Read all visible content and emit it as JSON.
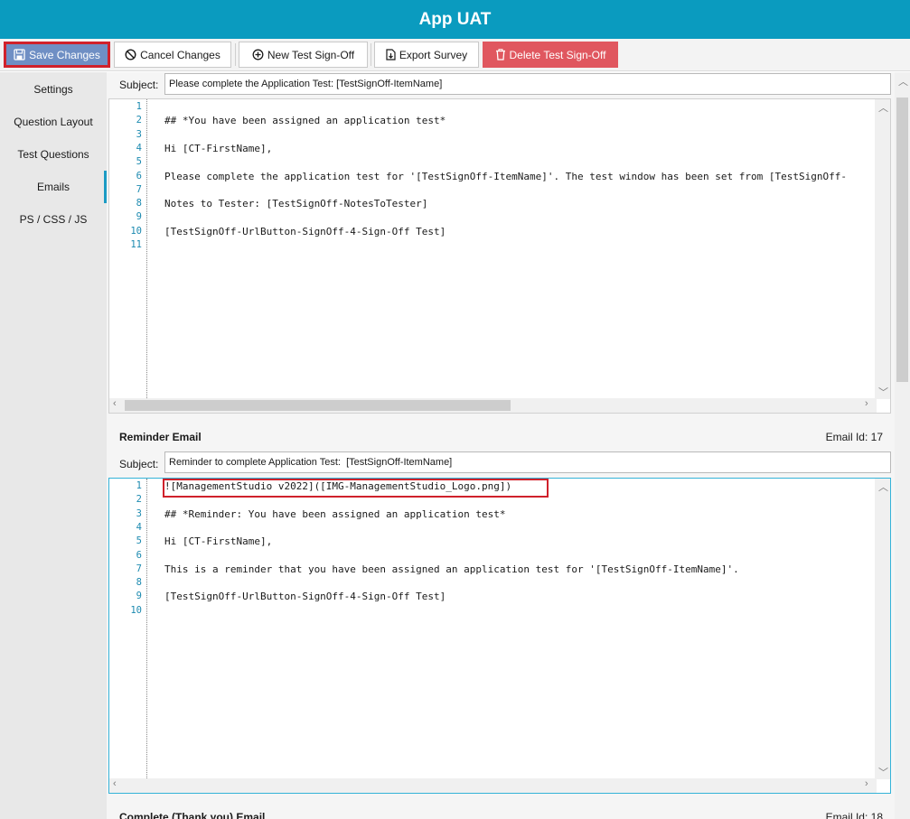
{
  "app": {
    "title": "App UAT"
  },
  "toolbar": {
    "save_label": "Save Changes",
    "cancel_label": "Cancel Changes",
    "new_label": "New Test Sign-Off",
    "export_label": "Export Survey",
    "delete_label": "Delete Test Sign-Off"
  },
  "sidebar": {
    "items": [
      {
        "label": "Settings"
      },
      {
        "label": "Question Layout"
      },
      {
        "label": "Test Questions"
      },
      {
        "label": "Emails"
      },
      {
        "label": "PS / CSS / JS"
      }
    ],
    "active": "Emails"
  },
  "emails": {
    "subject_label": "Subject:",
    "assigned": {
      "subject": "Please complete the Application Test: [TestSignOff-ItemName]",
      "line_numbers": [
        "1",
        "2",
        "3",
        "4",
        "5",
        "6",
        "7",
        "8",
        "9",
        "10",
        "11"
      ],
      "lines": [
        "",
        "## *You have been assigned an application test*",
        "",
        "Hi [CT-FirstName],",
        "",
        "Please complete the application test for '[TestSignOff-ItemName]'. The test window has been set from [TestSignOff-",
        "",
        "Notes to Tester: [TestSignOff-NotesToTester]",
        "",
        "[TestSignOff-UrlButton-SignOff-4-Sign-Off Test]",
        ""
      ]
    },
    "reminder": {
      "title": "Reminder Email",
      "email_id": "Email Id: 17",
      "subject": "Reminder to complete Application Test:  [TestSignOff-ItemName]",
      "line_numbers": [
        "1",
        "2",
        "3",
        "4",
        "5",
        "6",
        "7",
        "8",
        "9",
        "10"
      ],
      "lines": [
        "![ManagementStudio v2022]([IMG-ManagementStudio_Logo.png])",
        "",
        "## *Reminder: You have been assigned an application test*",
        "",
        "Hi [CT-FirstName],",
        "",
        "This is a reminder that you have been assigned an application test for '[TestSignOff-ItemName]'.",
        "",
        "[TestSignOff-UrlButton-SignOff-4-Sign-Off Test]",
        ""
      ]
    },
    "complete": {
      "title": "Complete (Thank you) Email",
      "email_id": "Email Id: 18"
    }
  },
  "colors": {
    "titlebar": "#0a9bbf",
    "accent": "#1c9bc4",
    "save": "#6f8fc4",
    "delete": "#e0575f",
    "highlight": "#d0212b"
  }
}
